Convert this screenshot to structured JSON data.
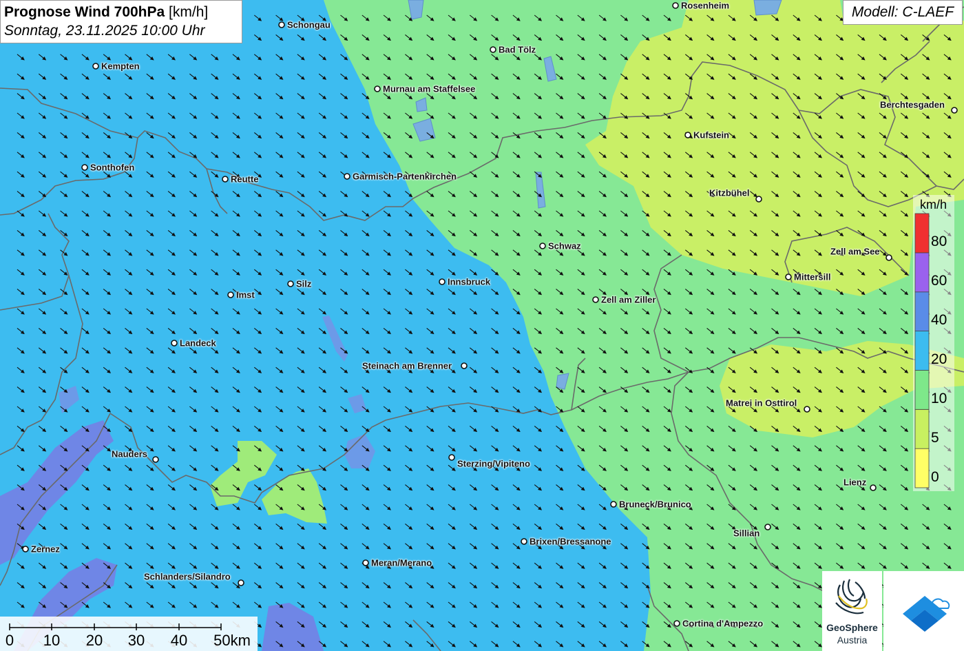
{
  "header": {
    "title_bold": "Prognose Wind 700hPa",
    "title_unit": "[km/h]",
    "datetime": "Sonntag, 23.11.2025 10:00 Uhr"
  },
  "model_label": "Modell: C-LAEF",
  "legend": {
    "unit": "km/h",
    "bands": [
      {
        "from": 0,
        "to": 5,
        "color": "#ffff66"
      },
      {
        "from": 5,
        "to": 10,
        "color": "#c8f060"
      },
      {
        "from": 10,
        "to": 20,
        "color": "#7ee88a"
      },
      {
        "from": 20,
        "to": 40,
        "color": "#3cbcf0"
      },
      {
        "from": 40,
        "to": 60,
        "color": "#5a8ce8"
      },
      {
        "from": 60,
        "to": 80,
        "color": "#9a62ee"
      },
      {
        "from": 80,
        "to": 100,
        "color": "#f03030"
      }
    ],
    "labels": [
      "0",
      "5",
      "10",
      "20",
      "40",
      "60",
      "80"
    ]
  },
  "scale": {
    "labels": [
      "0",
      "10",
      "20",
      "30",
      "40",
      "50km"
    ]
  },
  "cities": [
    {
      "name": "Rosenheim"
    },
    {
      "name": "Schongau"
    },
    {
      "name": "Bad Tölz"
    },
    {
      "name": "Kempten"
    },
    {
      "name": "Murnau am Staffelsee"
    },
    {
      "name": "Berchtesgaden"
    },
    {
      "name": "Kufstein"
    },
    {
      "name": "Sonthofen"
    },
    {
      "name": "Reutte"
    },
    {
      "name": "Garmisch-Partenkirchen"
    },
    {
      "name": "Kitzbühel"
    },
    {
      "name": "Schwaz"
    },
    {
      "name": "Zell am See"
    },
    {
      "name": "Mittersill"
    },
    {
      "name": "Silz"
    },
    {
      "name": "Innsbruck"
    },
    {
      "name": "Imst"
    },
    {
      "name": "Zell am Ziller"
    },
    {
      "name": "Landeck"
    },
    {
      "name": "Steinach am Brenner"
    },
    {
      "name": "Matrei in Osttirol"
    },
    {
      "name": "Nauders"
    },
    {
      "name": "Sterzing/Vipiteno"
    },
    {
      "name": "Lienz"
    },
    {
      "name": "Bruneck/Brunico"
    },
    {
      "name": "Sillian"
    },
    {
      "name": "Brixen/Bressanone"
    },
    {
      "name": "Zernez"
    },
    {
      "name": "Meran/Merano"
    },
    {
      "name": "Schlanders/Silandro"
    },
    {
      "name": "Cortina d'Ampezzo"
    }
  ],
  "logos": {
    "geosphere_line1": "GeoSphere",
    "geosphere_line2": "Austria"
  },
  "colors": {
    "arrow": "#111111",
    "border_line": "#666666",
    "lake": "#7aaee0"
  }
}
